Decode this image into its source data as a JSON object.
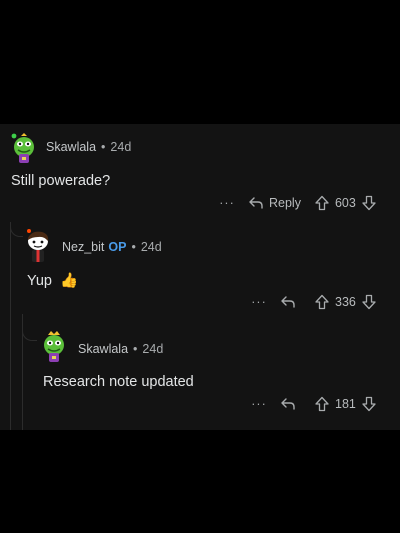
{
  "comments": [
    {
      "username": "Skawlala",
      "age": "24d",
      "op_badge": "",
      "text": "Still powerade?",
      "more": "···",
      "reply_label": "Reply",
      "votes": "603"
    },
    {
      "username": "Nez_bit",
      "age": "24d",
      "op_badge": "OP",
      "text": "Yup",
      "emoji": "👍",
      "more": "···",
      "reply_label": "",
      "votes": "336"
    },
    {
      "username": "Skawlala",
      "age": "24d",
      "op_badge": "",
      "text": "Research note updated",
      "more": "···",
      "reply_label": "",
      "votes": "181"
    }
  ],
  "colors": {
    "background": "#000000",
    "thread_bg": "#131313",
    "op_badge": "#4a9be8",
    "meta_text": "#a8abad",
    "body_text": "#e3e5e6"
  },
  "icons": [
    "reply-arrow-icon",
    "upvote-arrow-icon",
    "downvote-arrow-icon",
    "more-options-icon"
  ]
}
